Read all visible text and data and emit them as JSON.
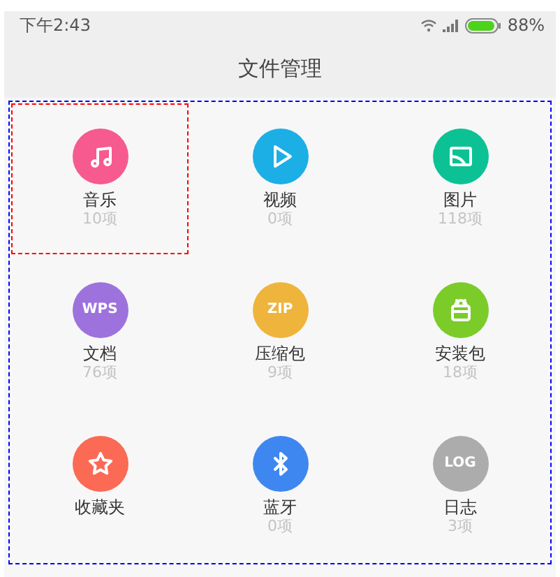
{
  "status_bar": {
    "time": "下午2:43",
    "battery": "88%"
  },
  "title": "文件管理",
  "categories": [
    {
      "kind": "music",
      "label": "音乐",
      "count": "10项",
      "color": "#f65a8e",
      "selected": true
    },
    {
      "kind": "video",
      "label": "视频",
      "count": "0项",
      "color": "#1bafe6",
      "selected": false
    },
    {
      "kind": "image",
      "label": "图片",
      "count": "118项",
      "color": "#0cc295",
      "selected": false
    },
    {
      "kind": "text",
      "icon_text": "WPS",
      "label": "文档",
      "count": "76项",
      "color": "#9d72dd",
      "selected": false
    },
    {
      "kind": "text",
      "icon_text": "ZIP",
      "label": "压缩包",
      "count": "9项",
      "color": "#efb43c",
      "selected": false
    },
    {
      "kind": "apk",
      "label": "安装包",
      "count": "18项",
      "color": "#7bcc29",
      "selected": false
    },
    {
      "kind": "star",
      "label": "收藏夹",
      "color": "#fb6a55",
      "selected": false
    },
    {
      "kind": "bluetooth",
      "label": "蓝牙",
      "count": "0项",
      "color": "#3f87f0",
      "selected": false
    },
    {
      "kind": "text",
      "icon_text": "LOG",
      "label": "日志",
      "count": "3项",
      "color": "#acacac",
      "selected": false
    }
  ]
}
